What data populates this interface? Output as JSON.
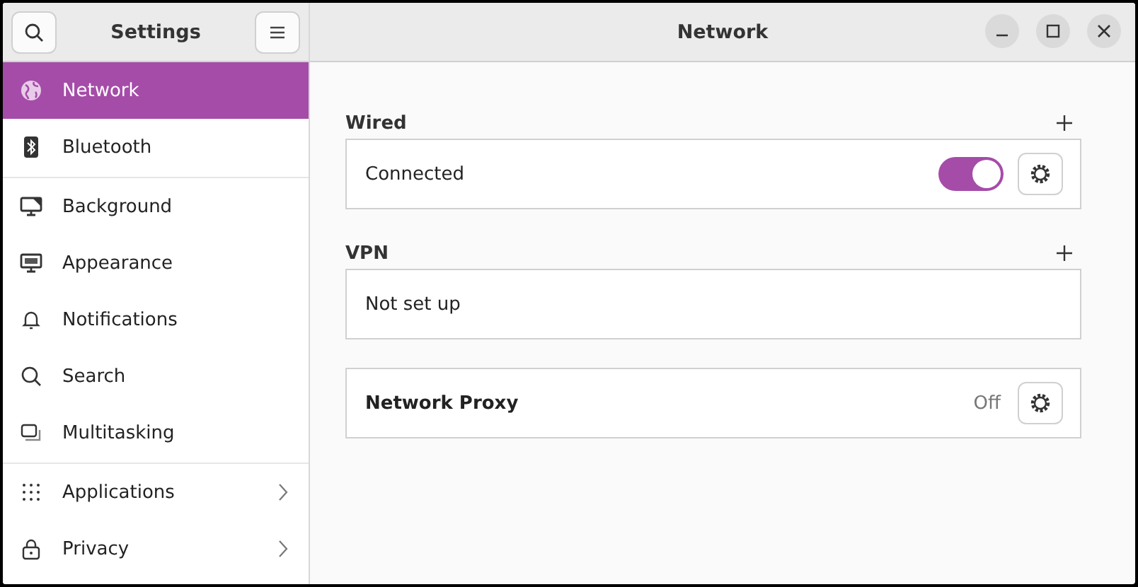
{
  "sidebar": {
    "title": "Settings",
    "groups": [
      {
        "items": [
          {
            "label": "Network",
            "selected": true,
            "kind": "page"
          },
          {
            "label": "Bluetooth",
            "selected": false,
            "kind": "page"
          }
        ]
      },
      {
        "items": [
          {
            "label": "Background",
            "selected": false,
            "kind": "page"
          },
          {
            "label": "Appearance",
            "selected": false,
            "kind": "page"
          },
          {
            "label": "Notifications",
            "selected": false,
            "kind": "page"
          },
          {
            "label": "Search",
            "selected": false,
            "kind": "page"
          },
          {
            "label": "Multitasking",
            "selected": false,
            "kind": "page"
          }
        ]
      },
      {
        "items": [
          {
            "label": "Applications",
            "selected": false,
            "kind": "submenu"
          },
          {
            "label": "Privacy",
            "selected": false,
            "kind": "submenu"
          }
        ]
      }
    ]
  },
  "window": {
    "title": "Network"
  },
  "sections": [
    {
      "title": "Wired",
      "rows": [
        {
          "kind": "toggle",
          "label": "Connected",
          "on": true
        }
      ]
    },
    {
      "title": "VPN",
      "rows": [
        {
          "kind": "plain",
          "label": "Not set up"
        }
      ]
    },
    {
      "rows": [
        {
          "kind": "status",
          "label": "Network Proxy",
          "status": "Off"
        }
      ]
    }
  ]
}
